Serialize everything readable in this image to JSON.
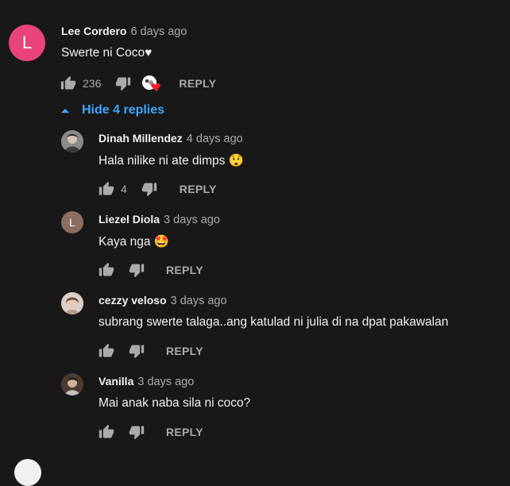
{
  "colors": {
    "background": "#181818",
    "text_primary": "#f1f1f1",
    "text_secondary": "#aaaaaa",
    "link_blue": "#3ea6ff",
    "avatar_pink": "#e8447a",
    "avatar_brown": "#8b6e61",
    "heart_red": "#ff1a2e"
  },
  "comment": {
    "avatar_letter": "L",
    "author": "Lee Cordero",
    "time": "6 days ago",
    "text": "Swerte ni Coco♥",
    "likes": "236",
    "reply_label": "REPLY",
    "hide_replies_label": "Hide 4 replies"
  },
  "replies": [
    {
      "author": "Dinah Millendez",
      "time": "4 days ago",
      "text": "Hala nilike ni ate dimps 😲",
      "likes": "4",
      "reply_label": "REPLY",
      "avatar": "photo"
    },
    {
      "author": "Liezel Diola",
      "time": "3 days ago",
      "text": "Kaya nga 🤩",
      "likes": "",
      "reply_label": "REPLY",
      "avatar": "letter",
      "avatar_letter": "L"
    },
    {
      "author": "cezzy veloso",
      "time": "3 days ago",
      "text": "subrang swerte talaga..ang katulad ni julia di na dpat pakawalan",
      "likes": "",
      "reply_label": "REPLY",
      "avatar": "photo"
    },
    {
      "author": "Vanilla",
      "time": "3 days ago",
      "text": "Mai anak naba sila ni coco?",
      "likes": "",
      "reply_label": "REPLY",
      "avatar": "photo"
    }
  ]
}
